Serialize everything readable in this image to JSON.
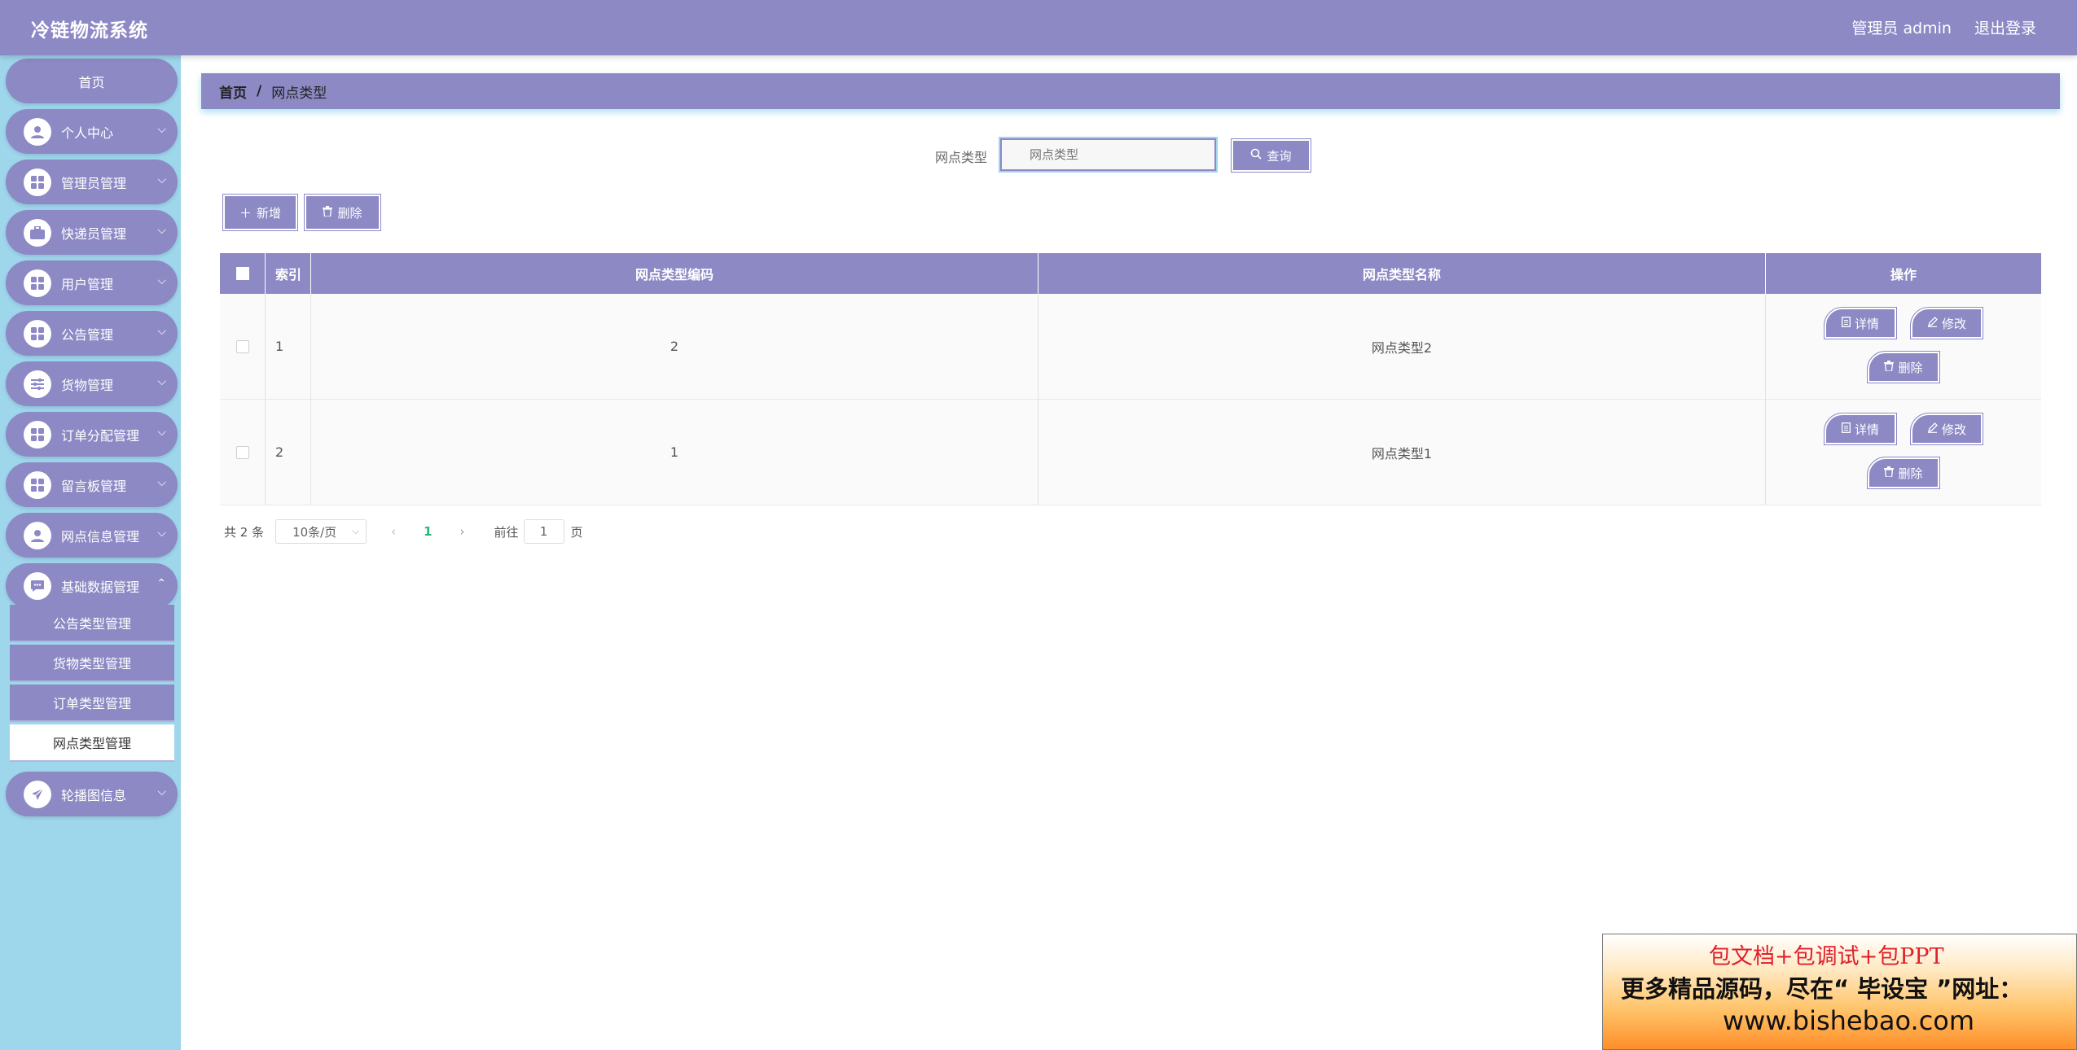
{
  "header": {
    "title": "冷链物流系统",
    "user": "管理员 admin",
    "logout": "退出登录"
  },
  "sidebar": {
    "home": "首页",
    "items": [
      {
        "label": "个人中心",
        "icon": "person-icon"
      },
      {
        "label": "管理员管理",
        "icon": "grid-icon"
      },
      {
        "label": "快递员管理",
        "icon": "briefcase-icon"
      },
      {
        "label": "用户管理",
        "icon": "grid-icon"
      },
      {
        "label": "公告管理",
        "icon": "grid-icon"
      },
      {
        "label": "货物管理",
        "icon": "sliders-icon"
      },
      {
        "label": "订单分配管理",
        "icon": "grid-icon"
      },
      {
        "label": "留言板管理",
        "icon": "grid-icon"
      },
      {
        "label": "网点信息管理",
        "icon": "person-icon"
      },
      {
        "label": "基础数据管理",
        "icon": "chat-icon"
      }
    ],
    "sub_items": [
      "公告类型管理",
      "货物类型管理",
      "订单类型管理",
      "网点类型管理"
    ],
    "last_item": {
      "label": "轮播图信息",
      "icon": "send-icon"
    }
  },
  "breadcrumb": {
    "home": "首页",
    "sep": "/",
    "current": "网点类型"
  },
  "search": {
    "label": "网点类型",
    "placeholder": "网点类型",
    "button": "查询"
  },
  "actions": {
    "add": "新增",
    "delete": "删除"
  },
  "table": {
    "headers": {
      "index": "索引",
      "code": "网点类型编码",
      "name": "网点类型名称",
      "ops": "操作"
    },
    "rows": [
      {
        "index": "1",
        "code": "2",
        "name": "网点类型2"
      },
      {
        "index": "2",
        "code": "1",
        "name": "网点类型1"
      }
    ],
    "ops": {
      "detail": "详情",
      "edit": "修改",
      "delete": "删除"
    }
  },
  "pagination": {
    "total": "共 2 条",
    "page_size": "10条/页",
    "current": "1",
    "goto": "前往",
    "goto_value": "1",
    "page_suffix": "页"
  },
  "ad": {
    "line1": "包文档+包调试+包PPT",
    "line2": "更多精品源码，尽在“ 毕设宝 ”网址：",
    "line3": "www.bishebao.com"
  },
  "colors": {
    "accent": "#8c89c5",
    "sidebar_bg": "#9ed6ec",
    "active_page": "#2bb37a"
  }
}
